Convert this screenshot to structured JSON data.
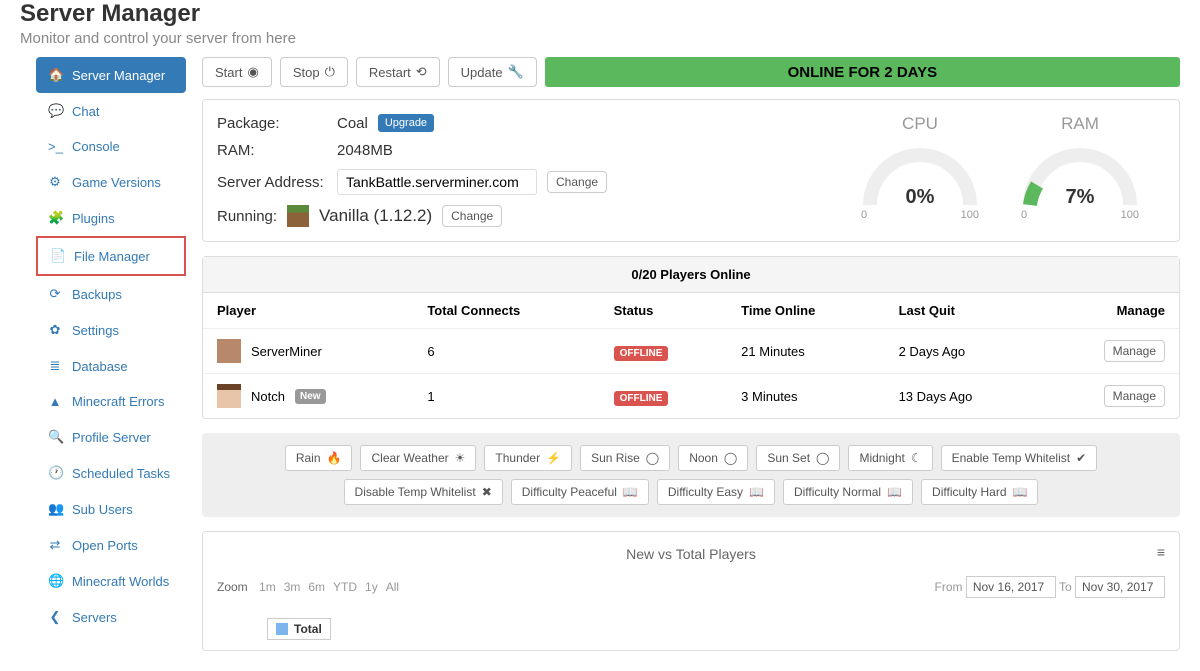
{
  "header": {
    "title": "Server Manager",
    "subtitle": "Monitor and control your server from here"
  },
  "sidebar": {
    "items": [
      {
        "icon": "🏠",
        "label": "Server Manager"
      },
      {
        "icon": "💬",
        "label": "Chat"
      },
      {
        "icon": ">_",
        "label": "Console"
      },
      {
        "icon": "⚙",
        "label": "Game Versions"
      },
      {
        "icon": "🧩",
        "label": "Plugins"
      },
      {
        "icon": "📄",
        "label": "File Manager"
      },
      {
        "icon": "⟳",
        "label": "Backups"
      },
      {
        "icon": "✿",
        "label": "Settings"
      },
      {
        "icon": "≣",
        "label": "Database"
      },
      {
        "icon": "▲",
        "label": "Minecraft Errors"
      },
      {
        "icon": "🔍",
        "label": "Profile Server"
      },
      {
        "icon": "🕐",
        "label": "Scheduled Tasks"
      },
      {
        "icon": "👥",
        "label": "Sub Users"
      },
      {
        "icon": "⇄",
        "label": "Open Ports"
      },
      {
        "icon": "🌐",
        "label": "Minecraft Worlds"
      },
      {
        "icon": "❮",
        "label": "Servers"
      }
    ]
  },
  "toolbar": {
    "start": "Start",
    "stop": "Stop",
    "restart": "Restart",
    "update": "Update",
    "status": "ONLINE FOR 2 DAYS"
  },
  "info": {
    "package_label": "Package:",
    "package_value": "Coal",
    "upgrade": "Upgrade",
    "ram_label": "RAM:",
    "ram_value": "2048MB",
    "addr_label": "Server Address:",
    "addr_value": "TankBattle.serverminer.com",
    "change": "Change",
    "running_label": "Running:",
    "running_value": "Vanilla (1.12.2)"
  },
  "gauges": {
    "cpu": {
      "title": "CPU",
      "value": "0%",
      "min": "0",
      "max": "100",
      "pct": 0
    },
    "ram": {
      "title": "RAM",
      "value": "7%",
      "min": "0",
      "max": "100",
      "pct": 7
    }
  },
  "players": {
    "header": "0/20 Players Online",
    "cols": {
      "player": "Player",
      "connects": "Total Connects",
      "status": "Status",
      "time": "Time Online",
      "quit": "Last Quit",
      "manage": "Manage"
    },
    "rows": [
      {
        "name": "ServerMiner",
        "new": false,
        "connects": "6",
        "status": "OFFLINE",
        "time": "21 Minutes",
        "quit": "2 Days Ago"
      },
      {
        "name": "Notch",
        "new": true,
        "connects": "1",
        "status": "OFFLINE",
        "time": "3 Minutes",
        "quit": "13 Days Ago"
      }
    ],
    "new_badge": "New",
    "manage_btn": "Manage"
  },
  "quick": [
    "Rain",
    "Clear Weather",
    "Thunder",
    "Sun Rise",
    "Noon",
    "Sun Set",
    "Midnight",
    "Enable Temp Whitelist",
    "Disable Temp Whitelist",
    "Difficulty Peaceful",
    "Difficulty Easy",
    "Difficulty Normal",
    "Difficulty Hard"
  ],
  "quick_icons": [
    "🔥",
    "☀",
    "⚡",
    "◯",
    "◯",
    "◯",
    "☾",
    "✔",
    "✖",
    "📖",
    "📖",
    "📖",
    "📖"
  ],
  "chart": {
    "title": "New vs Total Players",
    "zoom_label": "Zoom",
    "zoom": [
      "1m",
      "3m",
      "6m",
      "YTD",
      "1y",
      "All"
    ],
    "from_label": "From",
    "from_value": "Nov 16, 2017",
    "to_label": "To",
    "to_value": "Nov 30, 2017",
    "legend": "Total"
  },
  "chart_data": {
    "type": "line",
    "title": "New vs Total Players",
    "series": [
      {
        "name": "Total",
        "values": []
      }
    ],
    "x_range": [
      "2017-11-16",
      "2017-11-30"
    ]
  }
}
